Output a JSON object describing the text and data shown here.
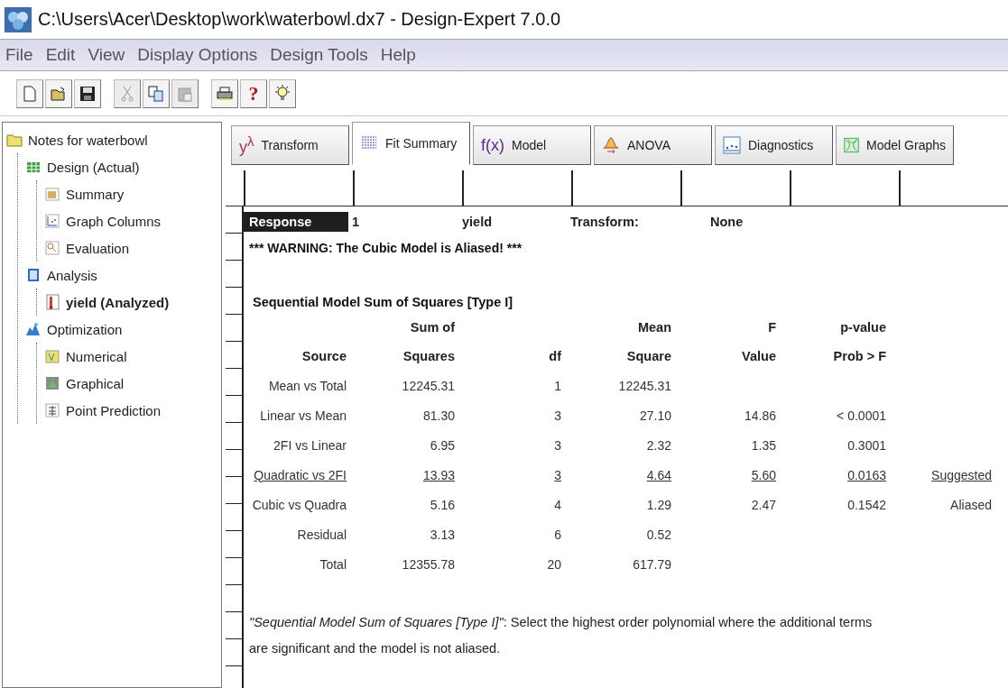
{
  "window": {
    "title": "C:\\Users\\Acer\\Desktop\\work\\waterbowl.dx7 - Design-Expert 7.0.0"
  },
  "menu": [
    "File",
    "Edit",
    "View",
    "Display Options",
    "Design Tools",
    "Help"
  ],
  "toolbar": [
    {
      "kind": "new",
      "disabled": false
    },
    {
      "kind": "open",
      "disabled": false
    },
    {
      "kind": "save",
      "disabled": false
    },
    {
      "kind": "cut",
      "disabled": true
    },
    {
      "kind": "copy",
      "disabled": false
    },
    {
      "kind": "paste",
      "disabled": true
    },
    {
      "kind": "print",
      "disabled": false
    },
    {
      "kind": "help",
      "label": "?",
      "disabled": false
    },
    {
      "kind": "tip",
      "disabled": false
    }
  ],
  "tree": [
    {
      "label": "Notes for waterbowl",
      "kind": "folder",
      "selected": false,
      "children": [
        {
          "label": "Design (Actual)",
          "kind": "design",
          "selected": false,
          "children": [
            {
              "label": "Summary",
              "kind": "summary",
              "selected": false
            },
            {
              "label": "Graph Columns",
              "kind": "graph",
              "selected": false
            },
            {
              "label": "Evaluation",
              "kind": "evaluation",
              "selected": false
            }
          ]
        },
        {
          "label": "Analysis",
          "kind": "analysis",
          "selected": false,
          "children": [
            {
              "label": "yield (Analyzed)",
              "kind": "response",
              "selected": true
            }
          ]
        },
        {
          "label": "Optimization",
          "kind": "optimization",
          "selected": false,
          "children": [
            {
              "label": "Numerical",
              "kind": "numerical",
              "selected": false
            },
            {
              "label": "Graphical",
              "kind": "graphical",
              "selected": false
            },
            {
              "label": "Point Prediction",
              "kind": "prediction",
              "selected": false
            }
          ]
        }
      ]
    }
  ],
  "tabs": [
    {
      "label": "Transform",
      "kind": "transform",
      "icon_text": "y$^{λ}$",
      "selected": false
    },
    {
      "label": "Fit Summary",
      "kind": "list",
      "selected": true
    },
    {
      "label": "Model",
      "kind": "model",
      "icon_text": "f(x)",
      "selected": false
    },
    {
      "label": "ANOVA",
      "kind": "anova",
      "selected": false
    },
    {
      "label": "Diagnostics",
      "kind": "diagnostics",
      "selected": false
    },
    {
      "label": "Model Graphs",
      "kind": "graphs",
      "selected": false
    }
  ],
  "response": {
    "label": "Response",
    "number": "1",
    "name": "yield",
    "transform_label": "Transform:",
    "transform": "None"
  },
  "warning": "*** WARNING:  The Cubic Model is Aliased! ***",
  "table": {
    "title": "Sequential Model Sum of Squares [Type I]",
    "columns": [
      {
        "heading": [
          "Source"
        ]
      },
      {
        "heading": [
          "Sum of",
          "Squares"
        ]
      },
      {
        "heading": [
          "df"
        ]
      },
      {
        "heading": [
          "Mean",
          "Square"
        ]
      },
      {
        "heading": [
          "F",
          "Value"
        ]
      },
      {
        "heading": [
          "p-value",
          "Prob > F"
        ]
      }
    ],
    "rows": [
      {
        "source": "Mean vs Total",
        "sum_of_squares": "12245.31",
        "df": "1",
        "mean_square": "12245.31",
        "underlined": false
      },
      {
        "source": "Linear vs Mean",
        "sum_of_squares": "81.30",
        "df": "3",
        "mean_square": "27.10",
        "f_value": "14.86",
        "p_value": "< 0.0001",
        "underlined": false
      },
      {
        "source": "2FI vs Linear",
        "sum_of_squares": "6.95",
        "df": "3",
        "mean_square": "2.32",
        "f_value": "1.35",
        "p_value": "0.3001",
        "underlined": false
      },
      {
        "source": "Quadratic vs 2FI",
        "sum_of_squares": "13.93",
        "df": "3",
        "mean_square": "4.64",
        "f_value": "5.60",
        "p_value": "0.0163",
        "note": "Suggested",
        "underlined": true
      },
      {
        "source": "Cubic vs Quadra",
        "sum_of_squares": "5.16",
        "df": "4",
        "mean_square": "1.29",
        "f_value": "2.47",
        "p_value": "0.1542",
        "note": "Aliased",
        "underlined": false
      },
      {
        "source": "Residual",
        "sum_of_squares": "3.13",
        "df": "6",
        "mean_square": "0.52",
        "underlined": false
      },
      {
        "source": "Total",
        "sum_of_squares": "12355.78",
        "df": "20",
        "mean_square": "617.79",
        "underlined": false
      }
    ]
  },
  "footnote": "*\"Sequential Model Sum of Squares [Type I]\"*:  Select the highest order polynomial where the additional terms are significant and the model is not aliased."
}
